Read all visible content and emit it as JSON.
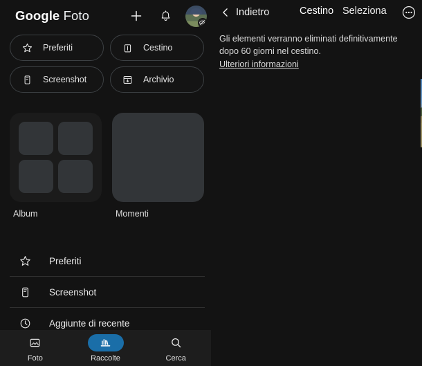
{
  "left": {
    "appbar": {
      "brand_google": "Google",
      "brand_foto": " Foto",
      "add_icon": "plus-icon",
      "notifications_icon": "bell-icon",
      "avatar_icon": "account-avatar",
      "avatar_badge_icon": "cloud-off-icon"
    },
    "chips": [
      {
        "label": "Preferiti",
        "icon": "star-outline-icon"
      },
      {
        "label": "Cestino",
        "icon": "trash-icon"
      },
      {
        "label": "Screenshot",
        "icon": "phone-screenshot-icon"
      },
      {
        "label": "Archivio",
        "icon": "archive-down-arrow-icon"
      }
    ],
    "cards": [
      {
        "label": "Album",
        "icon": "album-grid-icon"
      },
      {
        "label": "Momenti",
        "icon": "moments-card-icon"
      }
    ],
    "list": [
      {
        "label": "Preferiti",
        "icon": "star-outline-icon"
      },
      {
        "label": "Screenshot",
        "icon": "phone-screenshot-icon"
      },
      {
        "label": "Aggiunte di recente",
        "icon": "clock-icon"
      }
    ],
    "bottom_nav": {
      "items": [
        {
          "label": "Foto",
          "icon": "photo-icon",
          "active": false
        },
        {
          "label": "Raccolte",
          "icon": "collections-icon",
          "active": true
        },
        {
          "label": "Cerca",
          "icon": "search-icon",
          "active": false
        }
      ],
      "active_pill_color": "#1a6ea8"
    }
  },
  "right": {
    "appbar": {
      "back_label": "Indietro",
      "back_icon": "chevron-left-icon",
      "title": "Cestino",
      "select_label": "Seleziona",
      "more_icon": "more-circle-icon"
    },
    "notice": {
      "text": "Gli elementi verranno eliminati definitivamente dopo 60 giorni nel cestino.",
      "link": "Ulteriori informazioni"
    },
    "photo": {
      "name": "landscape-hillside-thumbnail",
      "alt": "Paesaggio collinare con cielo nuvoloso"
    }
  },
  "colors": {
    "background": "#131313",
    "surface": "#1d1d1d",
    "card": "#323538",
    "accent": "#1a6ea8",
    "text_primary": "#ffffff",
    "text_secondary": "#d8d8d8",
    "divider": "#303030",
    "chip_border": "#3c4043"
  }
}
